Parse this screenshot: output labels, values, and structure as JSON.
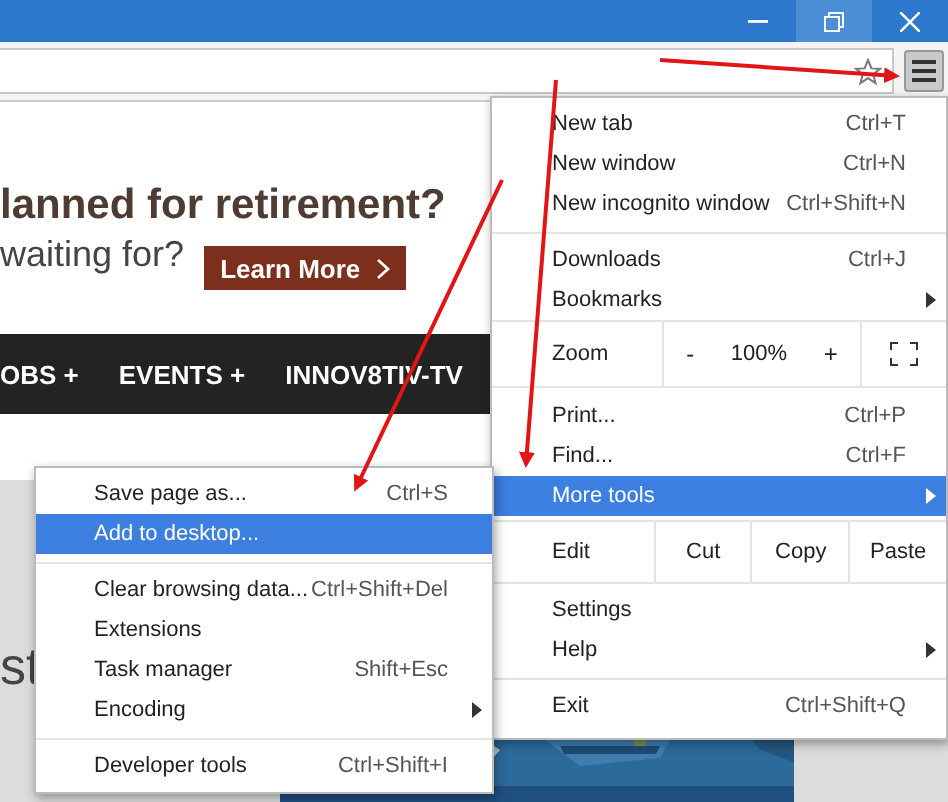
{
  "page": {
    "ad": {
      "headline": "lanned for retirement?",
      "subline": "waiting for?",
      "button": "Learn More"
    },
    "nav": [
      "OBS +",
      "EVENTS +",
      "INNOV8TIV-TV"
    ],
    "headline_fragment": "st"
  },
  "menu": [
    {
      "kind": "item",
      "label": "New tab",
      "shortcut": "Ctrl+T",
      "selected": false
    },
    {
      "kind": "item",
      "label": "New window",
      "shortcut": "Ctrl+N",
      "selected": false
    },
    {
      "kind": "item",
      "label": "New incognito window",
      "shortcut": "Ctrl+Shift+N",
      "selected": false
    },
    {
      "kind": "separator"
    },
    {
      "kind": "item",
      "label": "Downloads",
      "shortcut": "Ctrl+J",
      "selected": false
    },
    {
      "kind": "item",
      "label": "Bookmarks",
      "submenu": true,
      "selected": false
    },
    {
      "kind": "zoom",
      "label": "Zoom",
      "minus": "-",
      "value": "100%",
      "plus": "+"
    },
    {
      "kind": "item",
      "label": "Print...",
      "shortcut": "Ctrl+P",
      "selected": false
    },
    {
      "kind": "item",
      "label": "Find...",
      "shortcut": "Ctrl+F",
      "selected": false
    },
    {
      "kind": "item",
      "label": "More tools",
      "submenu": true,
      "selected": true
    },
    {
      "kind": "edit",
      "label": "Edit",
      "actions": [
        "Cut",
        "Copy",
        "Paste"
      ]
    },
    {
      "kind": "item",
      "label": "Settings",
      "selected": false
    },
    {
      "kind": "item",
      "label": "Help",
      "submenu": true,
      "selected": false
    },
    {
      "kind": "separator"
    },
    {
      "kind": "item",
      "label": "Exit",
      "shortcut": "Ctrl+Shift+Q",
      "selected": false
    }
  ],
  "submenu": [
    {
      "kind": "item",
      "label": "Save page as...",
      "shortcut": "Ctrl+S",
      "selected": false
    },
    {
      "kind": "item",
      "label": "Add to desktop...",
      "selected": true
    },
    {
      "kind": "separator"
    },
    {
      "kind": "item",
      "label": "Clear browsing data...",
      "shortcut": "Ctrl+Shift+Del",
      "selected": false
    },
    {
      "kind": "item",
      "label": "Extensions",
      "selected": false
    },
    {
      "kind": "item",
      "label": "Task manager",
      "shortcut": "Shift+Esc",
      "selected": false
    },
    {
      "kind": "item",
      "label": "Encoding",
      "submenu": true,
      "selected": false
    },
    {
      "kind": "separator"
    },
    {
      "kind": "item",
      "label": "Developer tools",
      "shortcut": "Ctrl+Shift+I",
      "selected": false
    }
  ]
}
